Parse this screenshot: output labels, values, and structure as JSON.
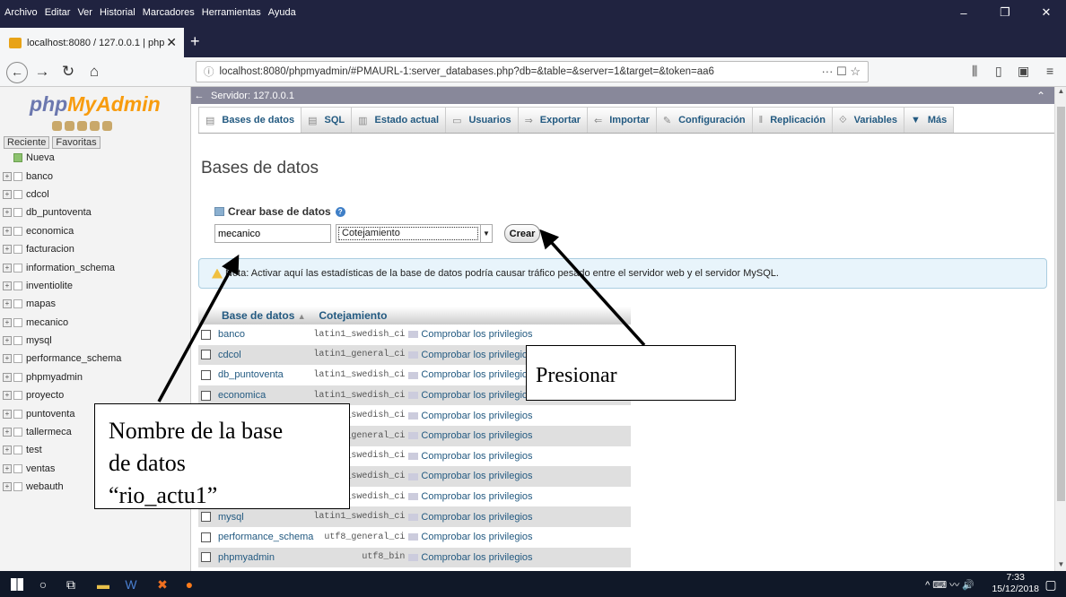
{
  "menubar": [
    "Archivo",
    "Editar",
    "Ver",
    "Historial",
    "Marcadores",
    "Herramientas",
    "Ayuda"
  ],
  "browser": {
    "tab_title": "localhost:8080 / 127.0.0.1 | php",
    "url": "localhost:8080/phpmyadmin/#PMAURL-1:server_databases.php?db=&table=&server=1&target=&token=aa6"
  },
  "sidebar": {
    "logo_php": "php",
    "logo_my": "MyAdmin",
    "recent": "Reciente",
    "favorites": "Favoritas",
    "new_label": "Nueva",
    "databases": [
      "banco",
      "cdcol",
      "db_puntoventa",
      "economica",
      "facturacion",
      "information_schema",
      "inventiolite",
      "mapas",
      "mecanico",
      "mysql",
      "performance_schema",
      "phpmyadmin",
      "proyecto",
      "puntoventa",
      "tallermeca",
      "test",
      "ventas",
      "webauth"
    ]
  },
  "server_bar": "Servidor: 127.0.0.1",
  "tabs": [
    "Bases de datos",
    "SQL",
    "Estado actual",
    "Usuarios",
    "Exportar",
    "Importar",
    "Configuración",
    "Replicación",
    "Variables",
    "Más"
  ],
  "page_title": "Bases de datos",
  "create": {
    "heading": "Crear base de datos",
    "db_name_value": "mecanico",
    "collation": "Cotejamiento",
    "button": "Crear"
  },
  "note": "Nota: Activar aquí las estadísticas de la base de datos podría causar tráfico pesado entre el servidor web y el servidor MySQL.",
  "table": {
    "headers": [
      "Base de datos",
      "Cotejamiento"
    ],
    "privileges_label": "Comprobar los privilegios",
    "rows": [
      {
        "name": "banco",
        "collation": "latin1_swedish_ci"
      },
      {
        "name": "cdcol",
        "collation": "latin1_general_ci"
      },
      {
        "name": "db_puntoventa",
        "collation": "latin1_swedish_ci"
      },
      {
        "name": "economica",
        "collation": "latin1_swedish_ci"
      },
      {
        "name": "",
        "collation": "_swedish_ci"
      },
      {
        "name": "",
        "collation": "_general_ci"
      },
      {
        "name": "",
        "collation": "_swedish_ci"
      },
      {
        "name": "",
        "collation": "_swedish_ci"
      },
      {
        "name": "",
        "collation": "_swedish_ci"
      },
      {
        "name": "mysql",
        "collation": "latin1_swedish_ci"
      },
      {
        "name": "performance_schema",
        "collation": "utf8_general_ci"
      },
      {
        "name": "phpmyadmin",
        "collation": "utf8_bin"
      }
    ]
  },
  "annotations": {
    "press": "Presionar",
    "name_line1": "Nombre de la base",
    "name_line2": "de datos",
    "name_line3": "“rio_actu1”"
  },
  "taskbar": {
    "time": "7:33",
    "date": "15/12/2018"
  }
}
